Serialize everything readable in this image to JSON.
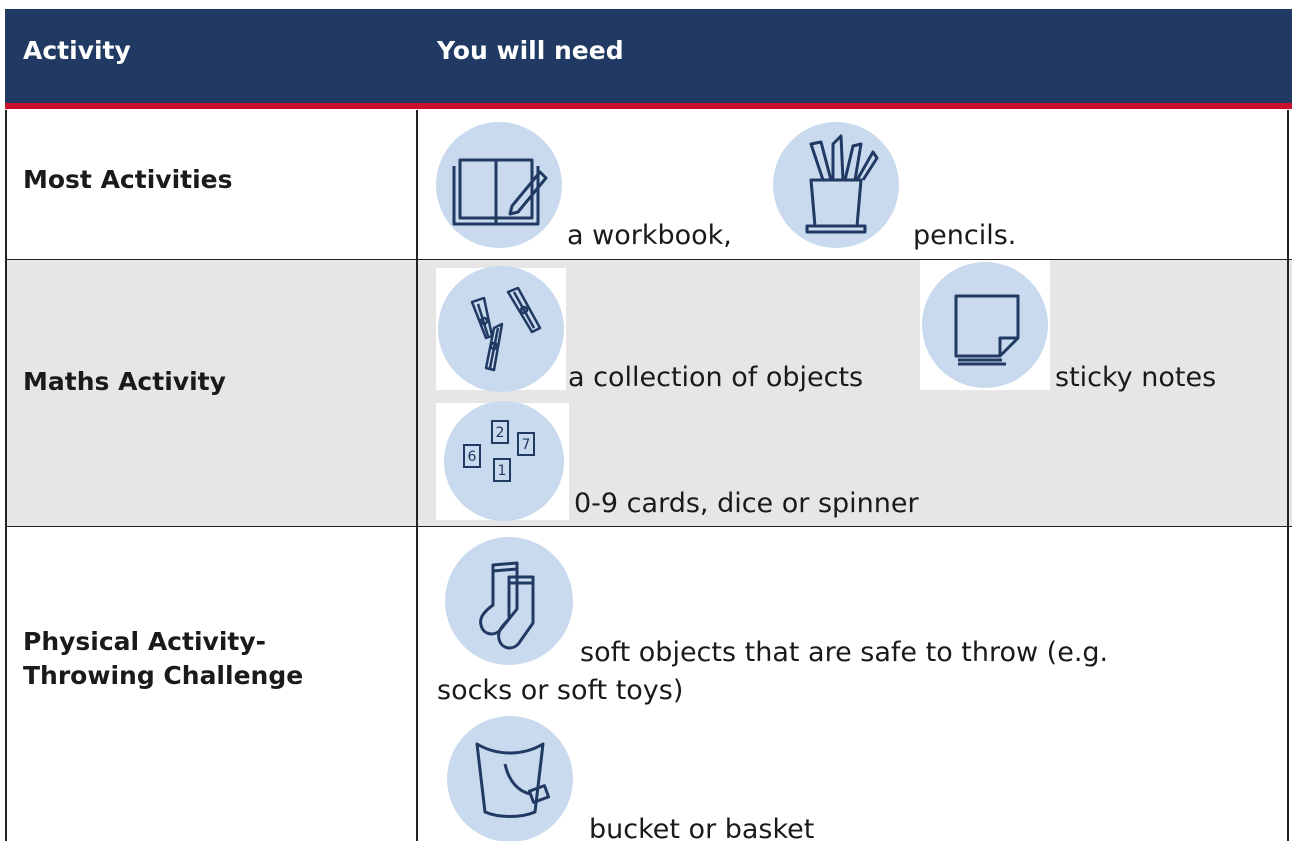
{
  "header": {
    "activity": "Activity",
    "need": "You will need"
  },
  "rows": [
    {
      "activity": "Most Activities",
      "items": [
        {
          "label": "a workbook,",
          "icon": "workbook-icon"
        },
        {
          "label": "pencils.",
          "icon": "pencils-icon"
        }
      ]
    },
    {
      "activity": "Maths Activity",
      "items": [
        {
          "label": "a collection of objects",
          "icon": "pegs-icon"
        },
        {
          "label": "sticky notes",
          "icon": "sticky-notes-icon"
        },
        {
          "label": "0-9 cards, dice or spinner",
          "icon": "number-cards-icon"
        }
      ]
    },
    {
      "activity_line1": "Physical Activity-",
      "activity_line2": "Throwing Challenge",
      "items": [
        {
          "label_line1": "soft objects that are safe to throw (e.g.",
          "label_line2": "socks or soft toys)",
          "icon": "socks-icon"
        },
        {
          "label": "bucket or basket",
          "icon": "bucket-icon"
        }
      ]
    }
  ],
  "cards": [
    "2",
    "7",
    "6",
    "1"
  ],
  "colors": {
    "header_bg": "#213a63",
    "header_rule": "#c8102e",
    "icon_circle": "#c9daee",
    "row_alt": "#e6e6e6"
  }
}
